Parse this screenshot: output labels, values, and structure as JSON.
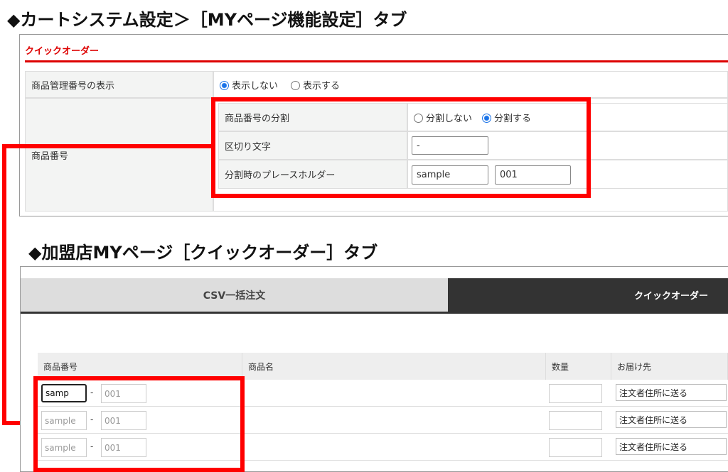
{
  "heading1": "◆カートシステム設定＞［MYページ機能設定］タブ",
  "heading2": "◆加盟店MYページ［クイックオーダー］タブ",
  "settings": {
    "section_title": "クイックオーダー",
    "row1": {
      "label": "商品管理番号の表示",
      "options": [
        "表示しない",
        "表示する"
      ],
      "selected": 0
    },
    "row2": {
      "label": "商品番号",
      "split": {
        "label": "商品番号の分割",
        "options": [
          "分割しない",
          "分割する"
        ],
        "selected": 1
      },
      "separator": {
        "label": "区切り文字",
        "value": "-"
      },
      "placeholder": {
        "label": "分割時のプレースホルダー",
        "value1": "sample",
        "value2": "001"
      }
    }
  },
  "mypage": {
    "tabs": [
      {
        "label": "CSV一括注文",
        "active": false
      },
      {
        "label": "クイックオーダー",
        "active": true
      }
    ],
    "columns": [
      "商品番号",
      "商品名",
      "数量",
      "お届け先"
    ],
    "rows": [
      {
        "part1": "samp",
        "part1_placeholder": "sample",
        "sep": "-",
        "part2_placeholder": "001",
        "dest": "注文者住所に送る"
      },
      {
        "part1": "",
        "part1_placeholder": "sample",
        "sep": "-",
        "part2_placeholder": "001",
        "dest": "注文者住所に送る"
      },
      {
        "part1": "",
        "part1_placeholder": "sample",
        "sep": "-",
        "part2_placeholder": "001",
        "dest": "注文者住所に送る"
      }
    ]
  },
  "colors": {
    "accent": "#ff0000",
    "tab_active": "#333333",
    "tab_inactive": "#dddddd",
    "radio": "#1a73e8"
  }
}
